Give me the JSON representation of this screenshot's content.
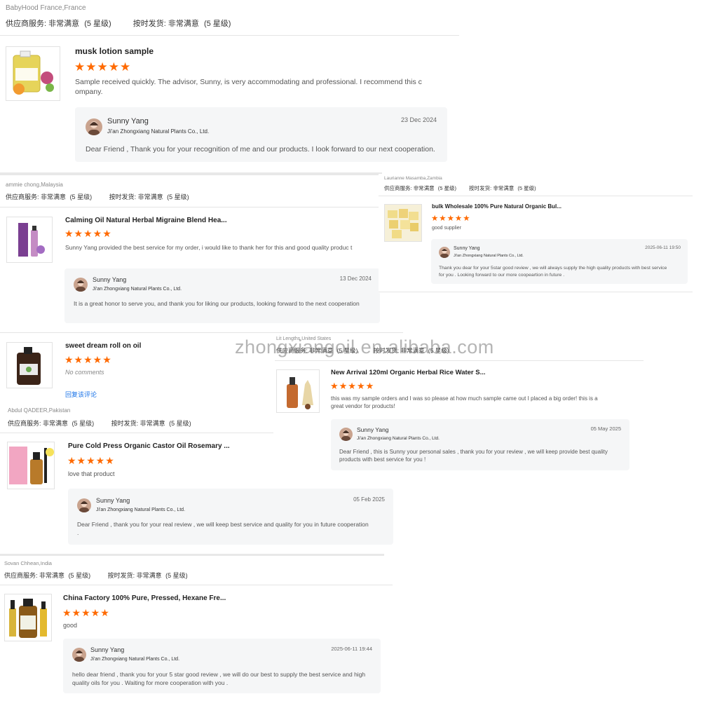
{
  "meta_labels": {
    "service_label": "供应商服务:",
    "service_value": "非常满意",
    "service_level": "(5 星级)",
    "delivery_label": "按时发货:",
    "delivery_value": "非常满意",
    "delivery_level": "(5 星级)"
  },
  "stars": "★★★★★",
  "star_color": "#ff6a00",
  "watermark": "zhongxiangoil.en.alibaba.com",
  "reviews": [
    {
      "reviewer": "BabyHood France,France",
      "product": "musk lotion sample",
      "comment": "Sample received quickly. The advisor, Sunny, is very accommodating and professional. I recommend this c ompany.",
      "rating": 5,
      "reply": {
        "name": "Sunny Yang",
        "company": "Ji'an Zhongxiang Natural Plants Co., Ltd.",
        "date": "23 Dec 2024",
        "text": "Dear Friend , Thank you for your recognition of me and our products. I look forward to our next cooperation."
      }
    },
    {
      "reviewer": "ammie chong,Malaysia",
      "product": "Calming Oil Natural Herbal Migraine Blend Hea...",
      "comment": "Sunny Yang provided the best service for my order, i would like to thank her for this and good quality produc t",
      "rating": 5,
      "reply": {
        "name": "Sunny Yang",
        "company": "Ji'an Zhongxiang Natural Plants Co., Ltd.",
        "date": "13 Dec 2024",
        "text": "It is a great honor to serve you, and thank you for liking our products, looking forward to the next cooperation"
      }
    },
    {
      "reviewer": "Laurianne Masamba,Zambia",
      "product": "bulk Wholesale 100% Pure Natural Organic Bul...",
      "comment": "good supplier",
      "rating": 5,
      "reply": {
        "name": "Sunny Yang",
        "company": "Ji'an Zhongxiang Natural Plants Co., Ltd.",
        "date": "2025-06-11 19:50",
        "text": "Thank you dear for your 5star good review , we will always supply the high quality products with best service for you . Looking forward to our more coopeartion in future ."
      }
    },
    {
      "reviewer": "",
      "product": "sweet dream roll on oil",
      "comment": "No comments",
      "rating": 5,
      "reply_link": "回复该评论"
    },
    {
      "reviewer": "Lit Lengths,United States",
      "product": "New Arrival 120ml Organic Herbal Rice Water S...",
      "comment": "this was my sample orders and I was so please at how much sample came out I placed a big order! this is a great vendor for products!",
      "rating": 5,
      "reply": {
        "name": "Sunny Yang",
        "company": "Ji'an Zhongxiang Natural Plants Co., Ltd.",
        "date": "05 May 2025",
        "text": "Dear Friend , this is Sunny your personal sales , thank you for your review , we will keep provide best quality products with best service for you !"
      }
    },
    {
      "reviewer": "Abdul QADEER,Pakistan",
      "product": "Pure Cold Press Organic Castor Oil Rosemary ...",
      "comment": "love that product",
      "rating": 5,
      "reply": {
        "name": "Sunny Yang",
        "company": "Ji'an Zhongxiang Natural Plants Co., Ltd.",
        "date": "05 Feb 2025",
        "text": "Dear Friend , thank you for your real review , we will keep best service and quality for you in future cooperation ."
      }
    },
    {
      "reviewer": "Sovan Chhean,India",
      "product": "China Factory 100% Pure, Pressed, Hexane Fre...",
      "comment": "good",
      "rating": 5,
      "reply": {
        "name": "Sunny Yang",
        "company": "Ji'an Zhongxiang Natural Plants Co., Ltd.",
        "date": "2025-06-11 19:44",
        "text": "hello dear friend , thank you for your 5 star good review , we will do our best to supply the best service and high quality oils for you . Waiting for more cooperation with you ."
      }
    }
  ]
}
